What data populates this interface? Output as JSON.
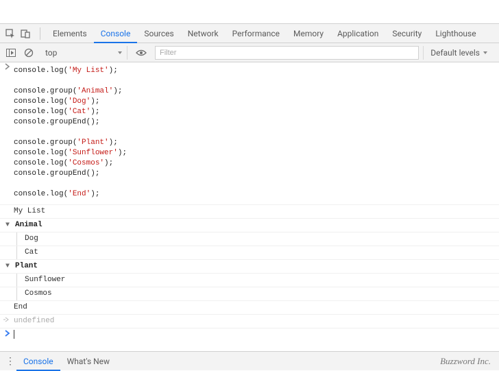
{
  "tabs": [
    "Elements",
    "Console",
    "Sources",
    "Network",
    "Performance",
    "Memory",
    "Application",
    "Security",
    "Lighthouse"
  ],
  "active_tab": "Console",
  "toolbar": {
    "context": "top",
    "filter_placeholder": "Filter",
    "levels_label": "Default levels"
  },
  "code_lines": [
    [
      {
        "t": "m",
        "v": "console.log("
      },
      {
        "t": "s",
        "v": "'My List'"
      },
      {
        "t": "m",
        "v": ");"
      }
    ],
    [],
    [
      {
        "t": "m",
        "v": "console.group("
      },
      {
        "t": "s",
        "v": "'Animal'"
      },
      {
        "t": "m",
        "v": ");"
      }
    ],
    [
      {
        "t": "m",
        "v": "console.log("
      },
      {
        "t": "s",
        "v": "'Dog'"
      },
      {
        "t": "m",
        "v": ");"
      }
    ],
    [
      {
        "t": "m",
        "v": "console.log("
      },
      {
        "t": "s",
        "v": "'Cat'"
      },
      {
        "t": "m",
        "v": ");"
      }
    ],
    [
      {
        "t": "m",
        "v": "console.groupEnd();"
      }
    ],
    [],
    [
      {
        "t": "m",
        "v": "console.group("
      },
      {
        "t": "s",
        "v": "'Plant'"
      },
      {
        "t": "m",
        "v": ");"
      }
    ],
    [
      {
        "t": "m",
        "v": "console.log("
      },
      {
        "t": "s",
        "v": "'Sunflower'"
      },
      {
        "t": "m",
        "v": ");"
      }
    ],
    [
      {
        "t": "m",
        "v": "console.log("
      },
      {
        "t": "s",
        "v": "'Cosmos'"
      },
      {
        "t": "m",
        "v": ");"
      }
    ],
    [
      {
        "t": "m",
        "v": "console.groupEnd();"
      }
    ],
    [],
    [
      {
        "t": "m",
        "v": "console.log("
      },
      {
        "t": "s",
        "v": "'End'"
      },
      {
        "t": "m",
        "v": ");"
      }
    ]
  ],
  "output": {
    "pre": [
      "My List"
    ],
    "groups": [
      {
        "title": "Animal",
        "items": [
          "Dog",
          "Cat"
        ]
      },
      {
        "title": "Plant",
        "items": [
          "Sunflower",
          "Cosmos"
        ]
      }
    ],
    "post": [
      "End"
    ],
    "return_value": "undefined"
  },
  "drawer": {
    "tabs": [
      "Console",
      "What's New"
    ],
    "active": "Console"
  },
  "brand": "Buzzword Inc."
}
